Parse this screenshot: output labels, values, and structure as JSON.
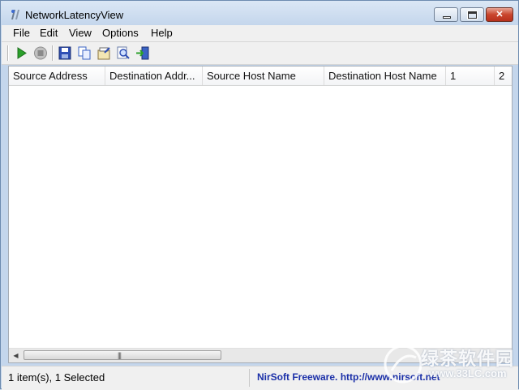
{
  "window": {
    "title": "NetworkLatencyView",
    "icon": "app-icon"
  },
  "menu": [
    "File",
    "Edit",
    "View",
    "Options",
    "Help"
  ],
  "toolbar": [
    "start-icon",
    "stop-icon",
    "save-icon",
    "copy-icon",
    "properties-icon",
    "find-icon",
    "exit-icon"
  ],
  "columns": [
    "Source Address",
    "Destination Addr...",
    "Source Host Name",
    "Destination Host Name",
    "1",
    "2"
  ],
  "status": {
    "items": "1 item(s), 1 Selected",
    "link": "NirSoft Freeware.  http://www.nirsoft.net"
  },
  "watermark": {
    "text": "绿茶软件园",
    "url": "www.33LC.com"
  },
  "colors": {
    "titlebar": "#c4d6ec",
    "link": "#1a2fa8",
    "play": "#2aa02a"
  }
}
